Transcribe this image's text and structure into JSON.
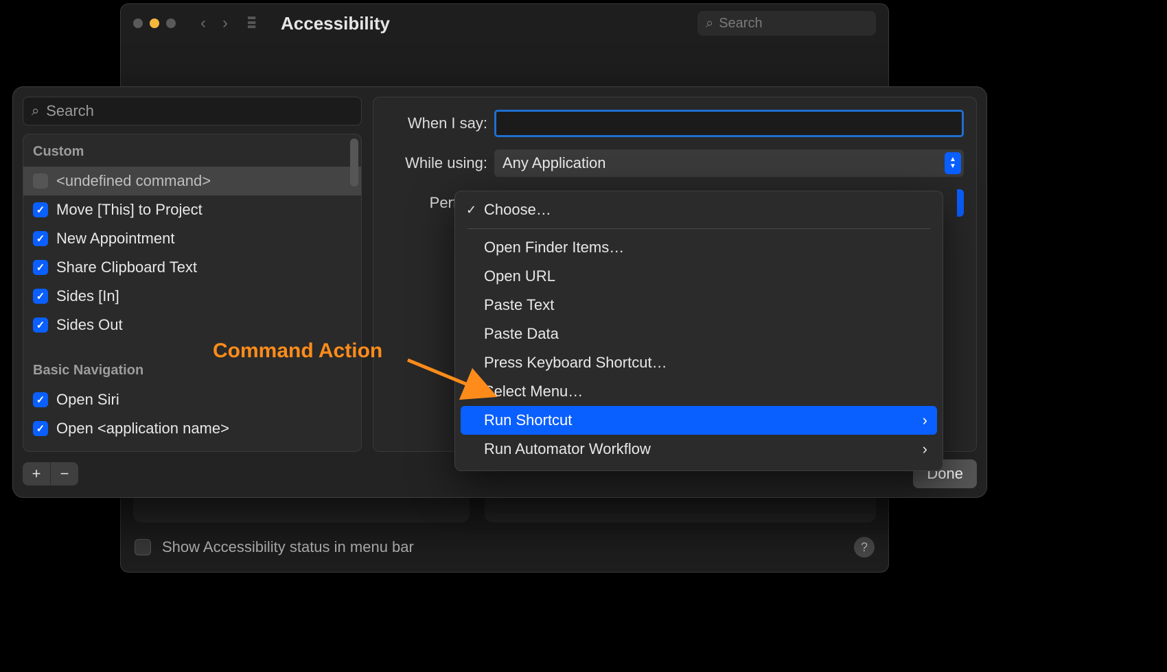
{
  "bg": {
    "title": "Accessibility",
    "search_placeholder": "Search",
    "show_status_label": "Show Accessibility status in menu bar"
  },
  "sheet": {
    "search_placeholder": "Search",
    "groups": [
      {
        "name": "Custom",
        "items": [
          {
            "label": "<undefined command>",
            "checked": false,
            "selected": true
          },
          {
            "label": "Move [This] to Project",
            "checked": true
          },
          {
            "label": "New Appointment",
            "checked": true
          },
          {
            "label": "Share Clipboard Text",
            "checked": true
          },
          {
            "label": "Sides [In]",
            "checked": true
          },
          {
            "label": "Sides Out",
            "checked": true
          }
        ]
      },
      {
        "name": "Basic Navigation",
        "items": [
          {
            "label": "Open Siri",
            "checked": true
          },
          {
            "label": "Open <application name>",
            "checked": true
          }
        ]
      }
    ],
    "form": {
      "when_label": "When I say:",
      "while_label": "While using:",
      "while_value": "Any Application",
      "perform_label": "Perform:"
    },
    "menu": {
      "choose": "Choose…",
      "items": [
        {
          "label": "Open Finder Items…"
        },
        {
          "label": "Open URL"
        },
        {
          "label": "Paste Text"
        },
        {
          "label": "Paste Data"
        },
        {
          "label": "Press Keyboard Shortcut…"
        },
        {
          "label": "Select Menu…"
        },
        {
          "label": "Run Shortcut",
          "submenu": true,
          "hovered": true
        },
        {
          "label": "Run Automator Workflow",
          "submenu": true
        }
      ]
    },
    "done_label": "Done",
    "add_label": "+",
    "remove_label": "−"
  },
  "annotation": {
    "text": "Command Action"
  }
}
